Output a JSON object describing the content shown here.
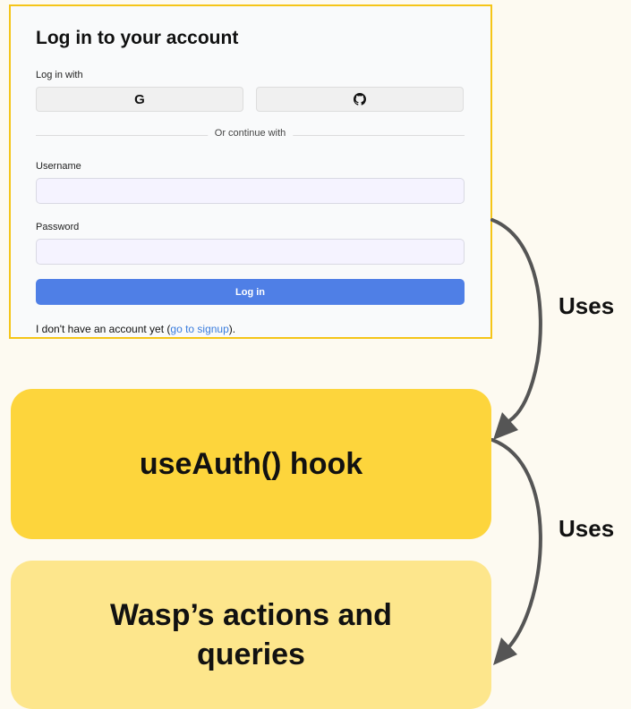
{
  "login": {
    "title": "Log in to your account",
    "login_with_label": "Log in with",
    "google_icon": "google-icon",
    "github_icon": "github-icon",
    "divider_text": "Or continue with",
    "username_label": "Username",
    "username_value": "",
    "password_label": "Password",
    "password_value": "",
    "login_button": "Log in",
    "signup_prefix": "I don't have an account yet (",
    "signup_link": "go to signup",
    "signup_suffix": ").",
    "border_color": "#f5c518",
    "button_color": "#4f7fe6"
  },
  "diagram": {
    "hook_box": "useAuth() hook",
    "wasp_box": "Wasp’s actions and queries",
    "arrow_label_1": "Uses",
    "arrow_label_2": "Uses",
    "hook_color": "#fdd53c",
    "wasp_color": "#fde68c"
  }
}
